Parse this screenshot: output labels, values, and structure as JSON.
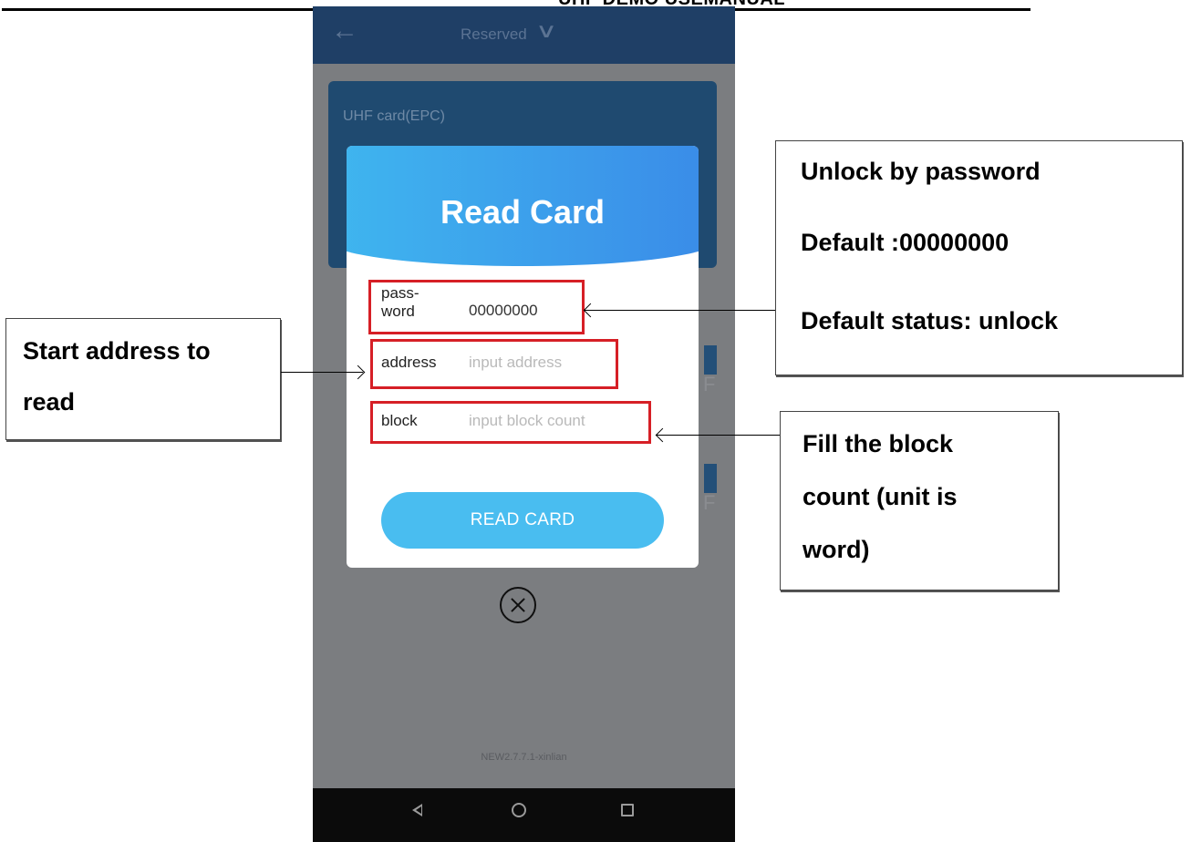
{
  "doc_header": {
    "title": "UHF DEMO USEMANUAL"
  },
  "app": {
    "back_icon": "arrow-left-icon",
    "title": "Reserved",
    "title_icon": "chevron-down-icon",
    "card_title": "UHF card(EPC)",
    "version": "NEW2.7.7.1-xinlian"
  },
  "dialog": {
    "title": "Read Card",
    "fields": [
      {
        "label": "pass-\nword",
        "value": "00000000",
        "placeholder": ""
      },
      {
        "label": "address",
        "value": "",
        "placeholder": "input address"
      },
      {
        "label": "block",
        "value": "",
        "placeholder": "input block count"
      }
    ],
    "button_label": "READ CARD",
    "close_icon": "close-circle-icon",
    "highlight_color": "#d61f26",
    "header_gradient": [
      "#3fb6ef",
      "#3a8be8"
    ]
  },
  "nav_bar": {
    "icons": [
      "back-triangle-icon",
      "home-circle-icon",
      "recent-square-icon"
    ]
  },
  "callouts": {
    "password": {
      "line1": "Unlock by password",
      "line2": "Default :00000000",
      "line3": "Default status: unlock"
    },
    "address": {
      "line1": "Start address to",
      "line2": "read"
    },
    "block": {
      "line1": "Fill the block",
      "line2": "count (unit is",
      "line3": "word)"
    }
  }
}
